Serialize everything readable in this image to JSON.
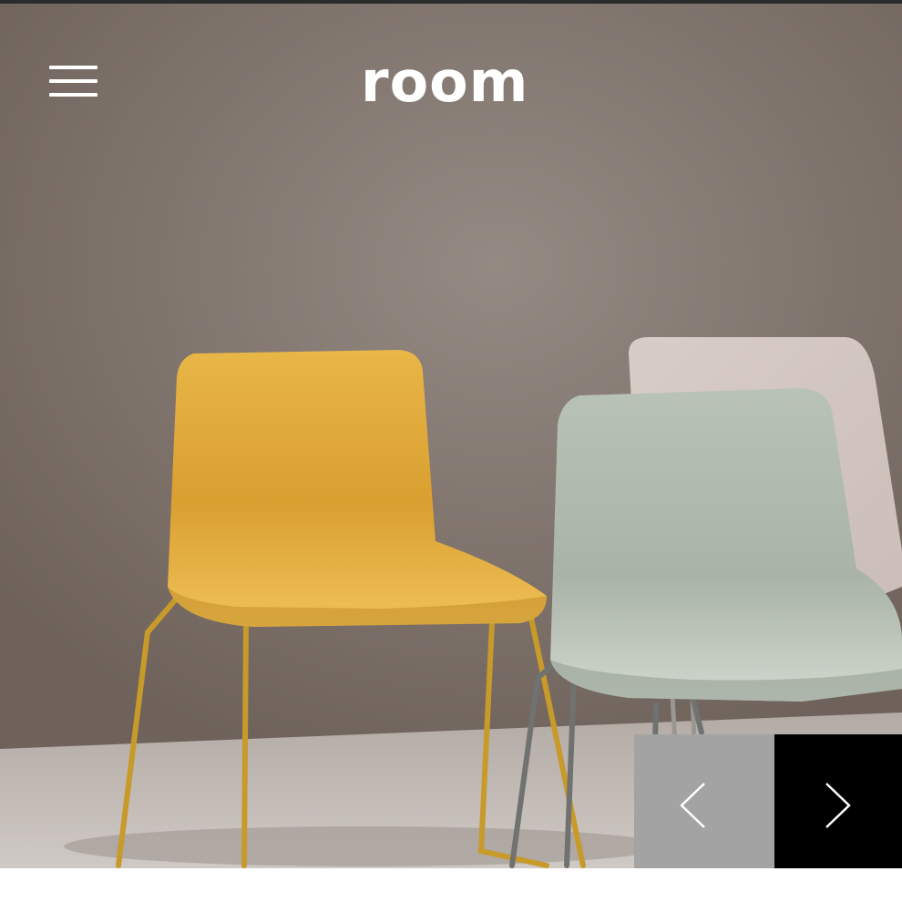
{
  "header": {
    "logo_text": "room",
    "menu_icon": "hamburger-menu-icon"
  },
  "hero": {
    "image_subject": "chairs-photo",
    "colors": {
      "wall": "#7f726a",
      "yellow_chair": "#e3ad3a",
      "sage_chair": "#bfc7bc",
      "blush_chair": "#d8cac5"
    }
  },
  "slider": {
    "prev_icon": "chevron-left-icon",
    "next_icon": "chevron-right-icon",
    "prev_bg": "#a3a3a3",
    "next_bg": "#000000"
  }
}
